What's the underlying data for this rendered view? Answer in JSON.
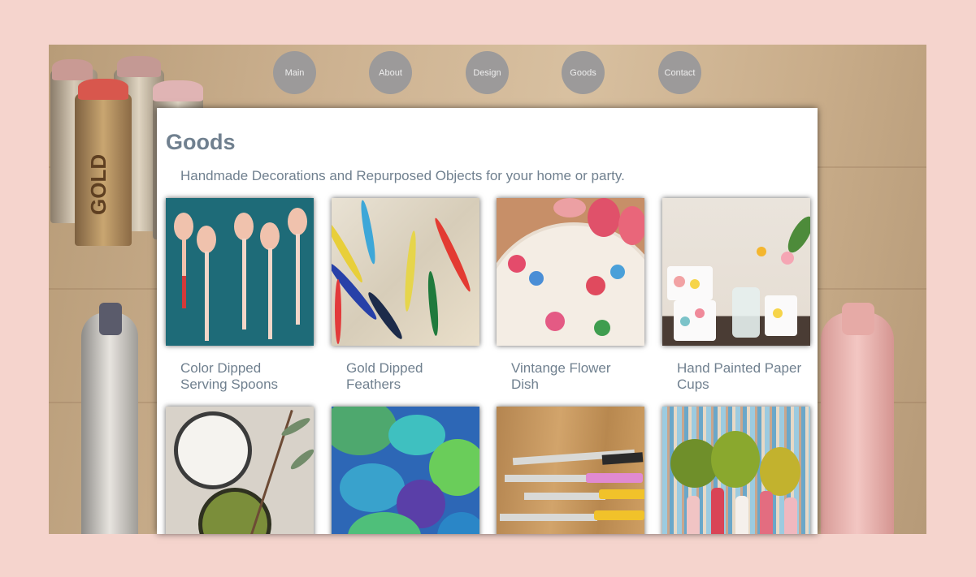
{
  "nav": {
    "items": [
      {
        "label": "Main"
      },
      {
        "label": "About"
      },
      {
        "label": "Design"
      },
      {
        "label": "Goods"
      },
      {
        "label": "Contact"
      }
    ]
  },
  "page": {
    "title": "Goods",
    "subtitle": "Handmade Decorations and Repurposed Objects for your home or party."
  },
  "products": [
    {
      "caption": "Color Dipped Serving Spoons"
    },
    {
      "caption": "Gold Dipped Feathers"
    },
    {
      "caption": "Vintange Flower Dish"
    },
    {
      "caption": "Hand Painted Paper Cups"
    },
    {
      "caption": ""
    },
    {
      "caption": ""
    },
    {
      "caption": ""
    },
    {
      "caption": ""
    }
  ],
  "background_label": "GOLD",
  "colors": {
    "page_bg": "#f5d4cd",
    "text": "#70808f",
    "nav_button": "#9c9a9a"
  }
}
